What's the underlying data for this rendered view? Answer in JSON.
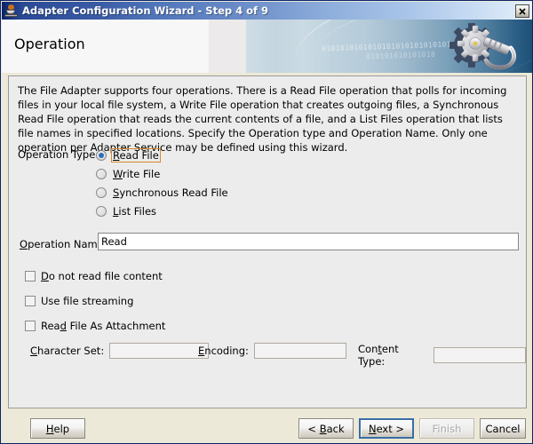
{
  "window": {
    "title": "Adapter Configuration Wizard - Step 4 of 9",
    "app_icon": "java-coffee-cup-icon",
    "close_label": "✕"
  },
  "banner": {
    "page_title": "Operation",
    "graphic": "gear-and-wrench-icon",
    "binary_line_1": "0101010101010101010101010101",
    "binary_line_2": "010101010101010"
  },
  "content": {
    "description": "The File Adapter supports four operations.  There is a Read File operation that polls for incoming files in your local file system, a Write File operation that creates outgoing files, a Synchronous Read File operation that reads the current contents of a file, and a List Files operation that lists file names in specified locations.  Specify the Operation type and Operation Name.  Only one operation per Adapter Service may be defined using this wizard.",
    "operation_type_label": "Operation Type:",
    "operation_types": [
      {
        "label": "Read File",
        "mnemonic": "R",
        "checked": true,
        "focused": true
      },
      {
        "label": "Write File",
        "mnemonic": "W",
        "checked": false,
        "focused": false
      },
      {
        "label": "Synchronous Read File",
        "mnemonic": "S",
        "checked": false,
        "focused": false
      },
      {
        "label": "List Files",
        "mnemonic": "L",
        "checked": false,
        "focused": false
      }
    ],
    "operation_name_label": "Operation Name:",
    "operation_name_mnemonic": "O",
    "operation_name_value": "Read",
    "checkboxes": [
      {
        "label": "Do not read file content",
        "mnemonic": "D",
        "checked": false
      },
      {
        "label": "Use file streaming",
        "mnemonic": "",
        "checked": false
      },
      {
        "label": "Read File As Attachment",
        "mnemonic": "d",
        "checked": false
      }
    ],
    "sub_fields": [
      {
        "label": "Character Set:",
        "mnemonic": "C",
        "value": "",
        "enabled": false
      },
      {
        "label": "Encoding:",
        "mnemonic": "E",
        "value": "",
        "enabled": false
      },
      {
        "label": "Content Type:",
        "mnemonic": "t",
        "value": "",
        "enabled": false
      }
    ]
  },
  "buttons": {
    "help": "Help",
    "back": "< Back",
    "next": "Next >",
    "finish": "Finish",
    "cancel": "Cancel"
  },
  "colors": {
    "title_start": "#0a246a",
    "title_end": "#e9f1fb",
    "focus_ring": "#d78a2a",
    "default_button_border": "#3a6ea5",
    "panel_bg": "#ececec"
  }
}
